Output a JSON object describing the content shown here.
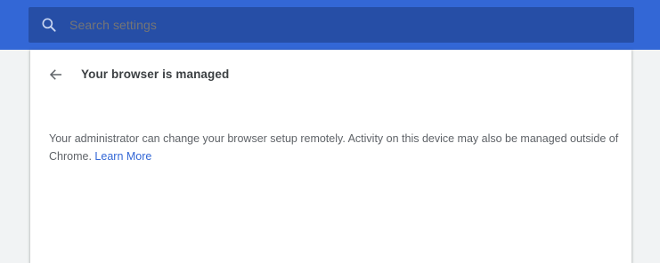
{
  "search": {
    "placeholder": "Search settings",
    "icon": "search-icon"
  },
  "page": {
    "title": "Your browser is managed",
    "back_icon": "back-arrow-icon",
    "description": "Your administrator can change your browser setup remotely. Activity on this device may also be managed outside of Chrome.",
    "learn_more": "Learn More"
  },
  "colors": {
    "header": "#3367d6",
    "search_box": "#264ea6",
    "link": "#3367d6",
    "background": "#f1f3f4"
  }
}
